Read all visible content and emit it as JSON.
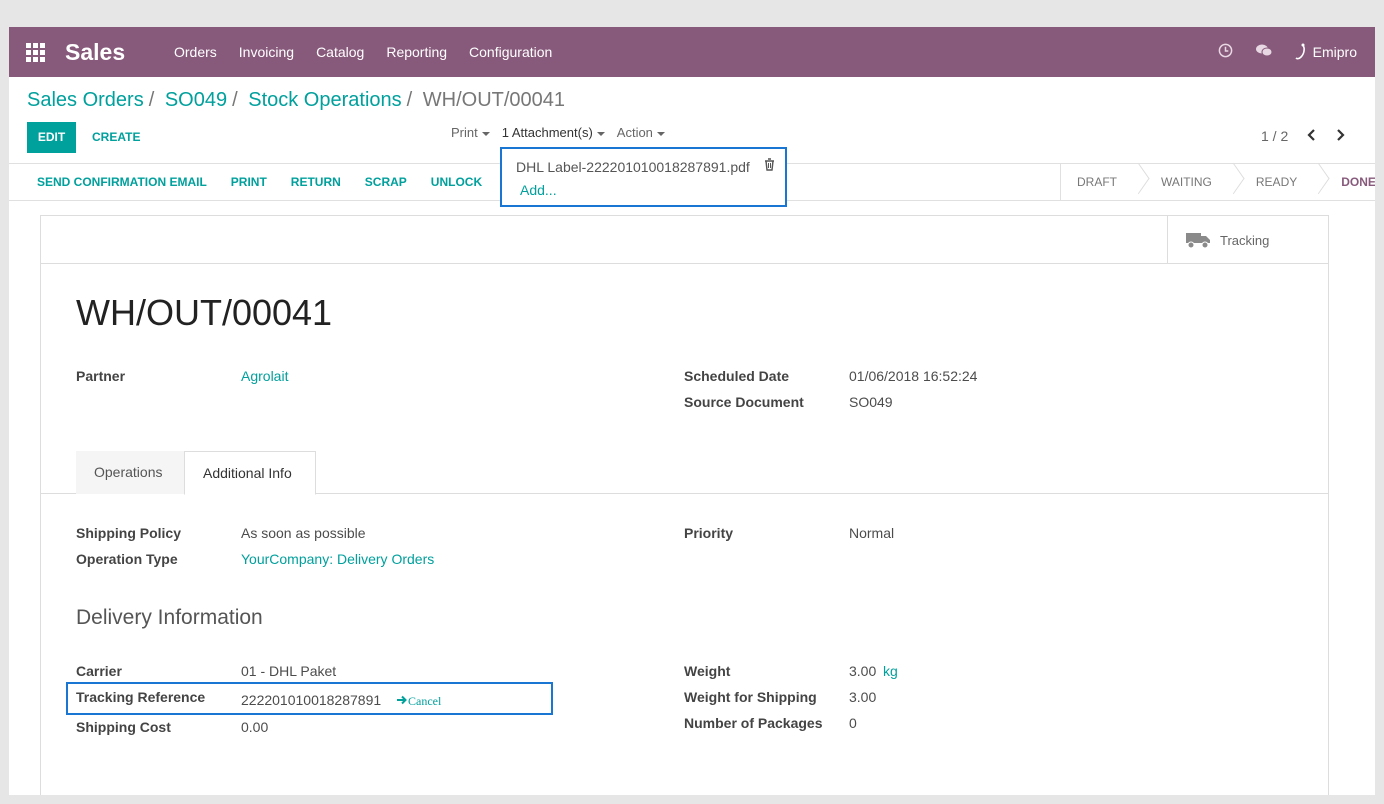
{
  "navbar": {
    "brand": "Sales",
    "menu": [
      "Orders",
      "Invoicing",
      "Catalog",
      "Reporting",
      "Configuration"
    ],
    "user": "Emipro"
  },
  "breadcrumb": [
    "Sales Orders",
    "SO049",
    "Stock Operations",
    "WH/OUT/00041"
  ],
  "buttons": {
    "edit": "EDIT",
    "create": "CREATE"
  },
  "sidebar": {
    "print": "Print",
    "attachments": "1 Attachment(s)",
    "action": "Action"
  },
  "pager": {
    "value": "1 / 2"
  },
  "attachment_dropdown": {
    "file": "DHL Label-222201010018287891.pdf",
    "add": "Add..."
  },
  "actions": [
    "SEND CONFIRMATION EMAIL",
    "PRINT",
    "RETURN",
    "SCRAP",
    "UNLOCK"
  ],
  "stages": [
    "DRAFT",
    "WAITING",
    "READY",
    "DONE"
  ],
  "active_stage": "DONE",
  "smart_button": "Tracking",
  "record": {
    "title": "WH/OUT/00041",
    "partner_label": "Partner",
    "partner": "Agrolait",
    "scheduled_label": "Scheduled Date",
    "scheduled": "01/06/2018 16:52:24",
    "source_label": "Source Document",
    "source": "SO049"
  },
  "tabs": [
    "Operations",
    "Additional Info"
  ],
  "additional": {
    "shipping_policy_label": "Shipping Policy",
    "shipping_policy": "As soon as possible",
    "operation_type_label": "Operation Type",
    "operation_type": "YourCompany: Delivery Orders",
    "priority_label": "Priority",
    "priority": "Normal"
  },
  "delivery": {
    "title": "Delivery Information",
    "carrier_label": "Carrier",
    "carrier": "01 - DHL Paket",
    "tracking_label": "Tracking Reference",
    "tracking": "222201010018287891",
    "cancel": "Cancel",
    "cost_label": "Shipping Cost",
    "cost": "0.00",
    "weight_label": "Weight",
    "weight": "3.00",
    "weight_uom": "kg",
    "weight_ship_label": "Weight for Shipping",
    "weight_ship": "3.00",
    "packages_label": "Number of Packages",
    "packages": "0"
  },
  "colors": {
    "brand": "#875a7b",
    "accent": "#00a09d",
    "highlight": "#1976d2"
  }
}
